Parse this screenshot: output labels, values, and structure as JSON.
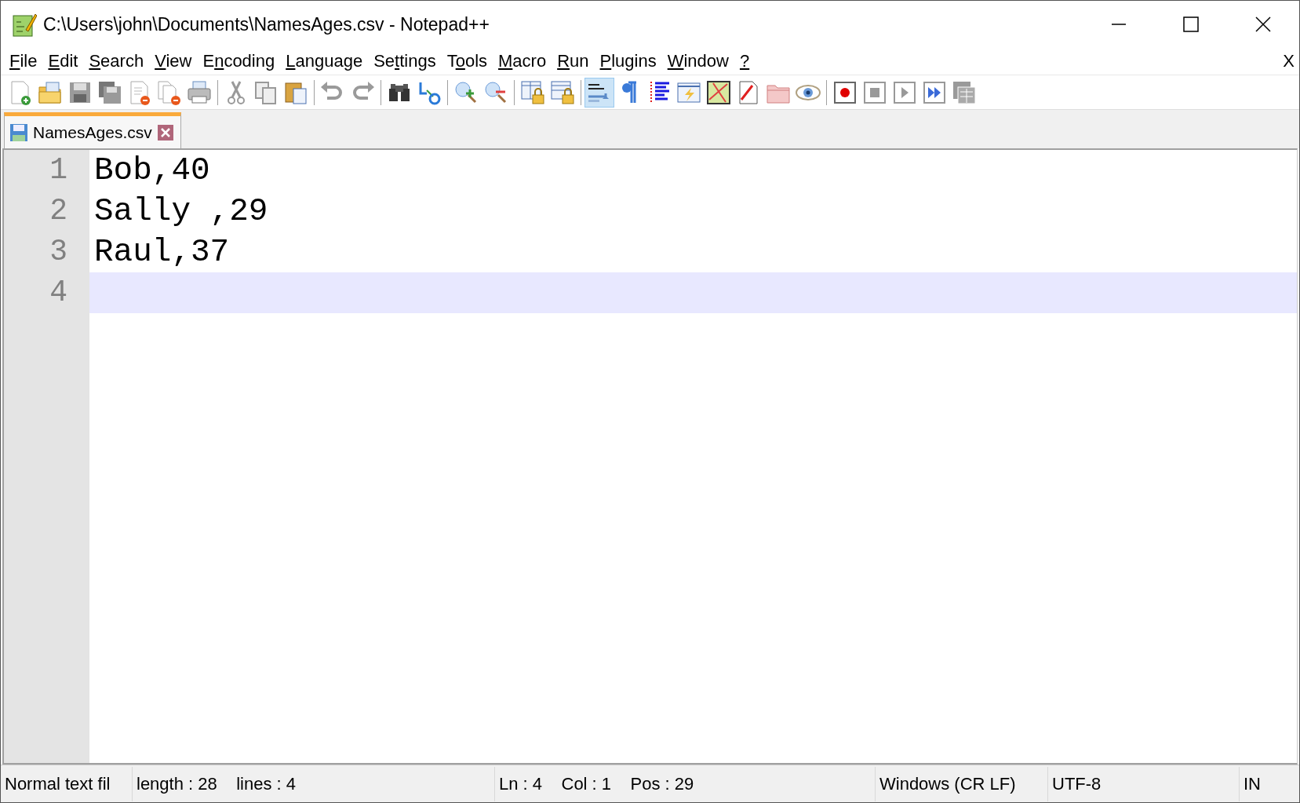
{
  "window": {
    "title": "C:\\Users\\john\\Documents\\NamesAges.csv - Notepad++"
  },
  "menu": [
    {
      "key": "F",
      "post": "ile"
    },
    {
      "key": "E",
      "post": "dit"
    },
    {
      "key": "S",
      "post": "earch"
    },
    {
      "key": "V",
      "post": "iew"
    },
    {
      "pre": "E",
      "key": "n",
      "post": "coding"
    },
    {
      "key": "L",
      "post": "anguage"
    },
    {
      "pre": "Se",
      "key": "t",
      "post": "tings"
    },
    {
      "pre": "T",
      "key": "o",
      "post": "ols"
    },
    {
      "key": "M",
      "post": "acro"
    },
    {
      "key": "R",
      "post": "un"
    },
    {
      "key": "P",
      "post": "lugins"
    },
    {
      "key": "W",
      "post": "indow"
    },
    {
      "key": "?"
    }
  ],
  "menu_close": "X",
  "toolbar": [
    [
      {
        "pressed": false
      },
      {
        "pressed": false
      },
      {
        "pressed": false
      },
      {
        "pressed": false
      },
      {
        "pressed": false
      },
      {
        "pressed": false
      },
      {
        "pressed": false
      }
    ],
    [
      {
        "pressed": false
      },
      {
        "pressed": false
      },
      {
        "pressed": false
      }
    ],
    [
      {
        "pressed": false
      },
      {
        "pressed": false
      }
    ],
    [
      {
        "pressed": false
      },
      {
        "pressed": false
      }
    ],
    [
      {
        "pressed": false
      },
      {
        "pressed": false
      }
    ],
    [
      {
        "pressed": false
      },
      {
        "pressed": false
      }
    ],
    [
      {
        "pressed": true
      },
      {
        "pressed": false
      },
      {
        "pressed": false
      },
      {
        "pressed": false
      },
      {
        "pressed": false
      },
      {
        "pressed": false
      },
      {
        "pressed": false
      },
      {
        "pressed": false
      }
    ],
    [
      {
        "pressed": false
      },
      {
        "pressed": false
      },
      {
        "pressed": false
      },
      {
        "pressed": false
      },
      {
        "pressed": false
      }
    ]
  ],
  "tabs": [
    {
      "label": "NamesAges.csv",
      "selected": true
    }
  ],
  "editor": {
    "lines": [
      {
        "number": "1",
        "text": "Bob,40",
        "current": false
      },
      {
        "number": "2",
        "text": "Sally ,29",
        "current": false
      },
      {
        "number": "3",
        "text": "Raul,37",
        "current": false
      },
      {
        "number": "4",
        "current": true
      }
    ]
  },
  "status_bar": [
    {
      "text": "Normal text fil"
    },
    {
      "text": "length : 28    lines : 4"
    },
    {
      "text": "Ln : 4    Col : 1    Pos : 29"
    },
    {
      "text": "Windows (CR LF)"
    },
    {
      "text": "UTF-8"
    },
    {
      "text": "IN"
    }
  ]
}
